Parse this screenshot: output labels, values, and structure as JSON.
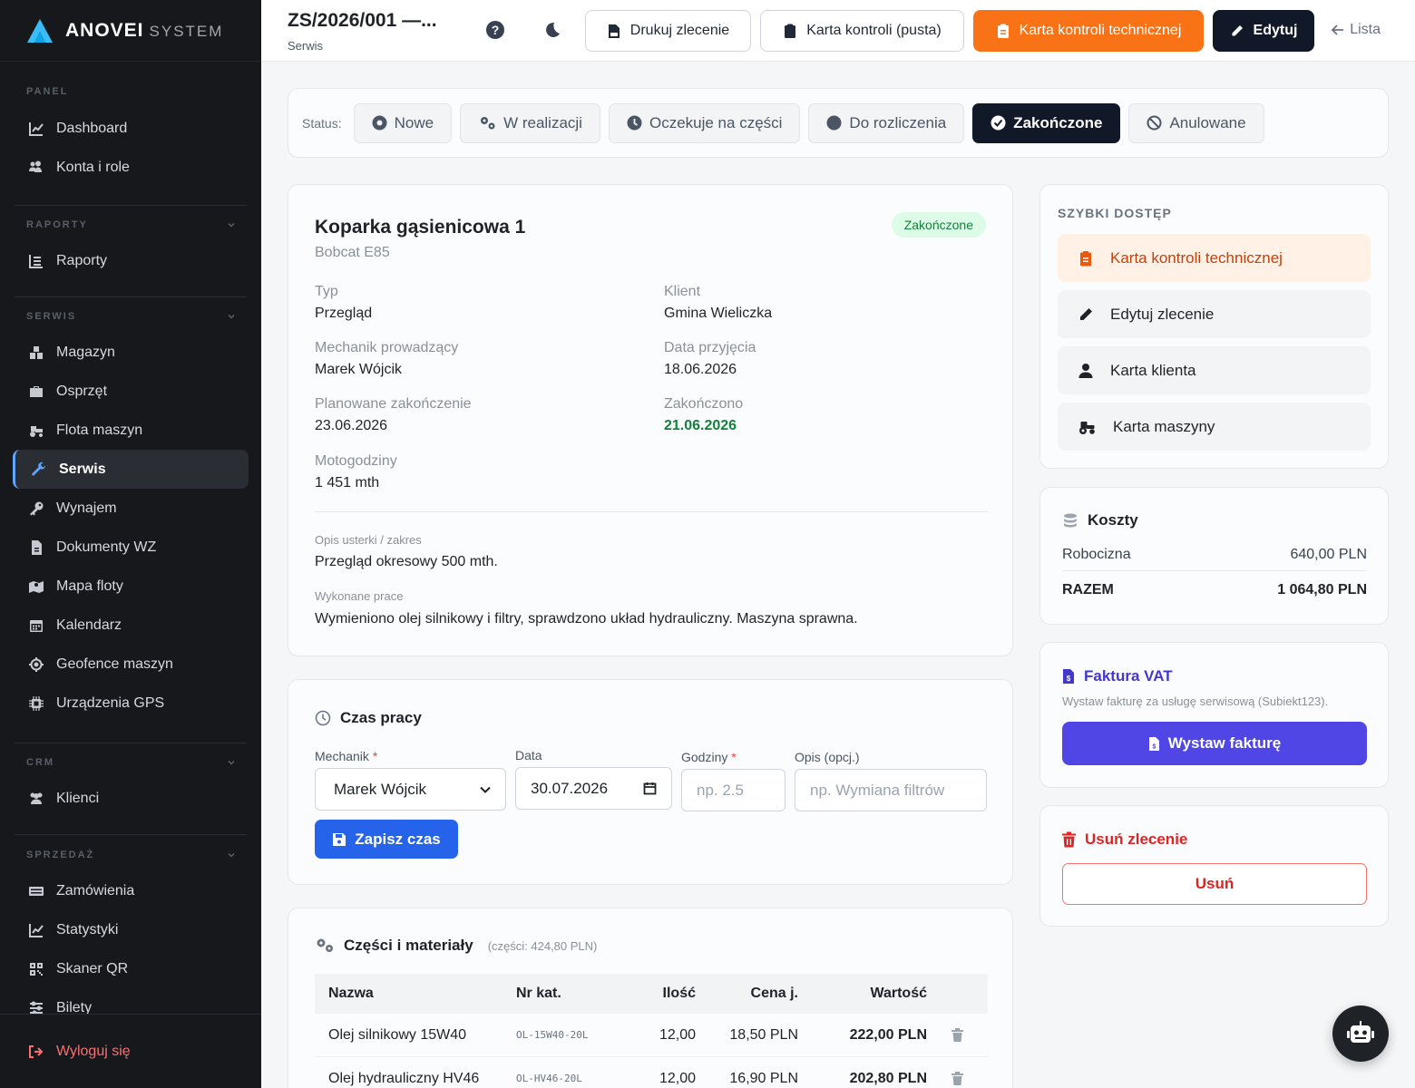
{
  "brand": {
    "name": "ANOVEI",
    "sub": "SYSTEM"
  },
  "sidebar": {
    "sections": [
      {
        "title": "PANEL",
        "items": [
          {
            "label": "Dashboard",
            "icon": "chart-line-icon"
          },
          {
            "label": "Konta i role",
            "icon": "users-gear-icon"
          }
        ]
      },
      {
        "title": "RAPORTY",
        "items": [
          {
            "label": "Raporty",
            "icon": "list-icon"
          }
        ]
      },
      {
        "title": "SERWIS",
        "items": [
          {
            "label": "Magazyn",
            "icon": "boxes-icon"
          },
          {
            "label": "Osprzęt",
            "icon": "toolbox-icon"
          },
          {
            "label": "Flota maszyn",
            "icon": "tractor-icon"
          },
          {
            "label": "Serwis",
            "icon": "wrench-icon",
            "active": true
          },
          {
            "label": "Wynajem",
            "icon": "key-icon"
          },
          {
            "label": "Dokumenty WZ",
            "icon": "file-icon"
          },
          {
            "label": "Mapa floty",
            "icon": "map-icon"
          },
          {
            "label": "Kalendarz",
            "icon": "calendar-icon"
          },
          {
            "label": "Geofence maszyn",
            "icon": "crosshair-icon"
          },
          {
            "label": "Urządzenia GPS",
            "icon": "chip-icon"
          }
        ]
      },
      {
        "title": "CRM",
        "items": [
          {
            "label": "Klienci",
            "icon": "users-icon"
          }
        ]
      },
      {
        "title": "SPRZEDAŻ",
        "items": [
          {
            "label": "Zamówienia",
            "icon": "cash-register-icon"
          },
          {
            "label": "Statystyki",
            "icon": "chart-line-icon"
          },
          {
            "label": "Skaner QR",
            "icon": "qr-icon"
          },
          {
            "label": "Bilety",
            "icon": "sliders-icon"
          }
        ]
      }
    ],
    "logout": "Wyloguj się"
  },
  "topbar": {
    "title": "ZS/2026/001 —...",
    "subtitle": "Serwis",
    "print_label": "Drukuj zlecenie",
    "blank_card_label": "Karta kontroli (pusta)",
    "tech_card_label": "Karta kontroli technicznej",
    "edit_label": "Edytuj",
    "list_label": "Lista"
  },
  "status": {
    "label": "Status:",
    "options": [
      {
        "label": "Nowe",
        "icon": "circle-dot-icon"
      },
      {
        "label": "W realizacji",
        "icon": "gears-icon"
      },
      {
        "label": "Oczekuje na części",
        "icon": "clock-icon"
      },
      {
        "label": "Do rozliczenia",
        "icon": "circle-icon"
      },
      {
        "label": "Zakończone",
        "icon": "check-circle-icon",
        "active": true
      },
      {
        "label": "Anulowane",
        "icon": "ban-icon"
      }
    ]
  },
  "machine": {
    "name": "Koparka gąsienicowa 1",
    "model": "Bobcat E85",
    "badge": "Zakończone",
    "fields": {
      "type_label": "Typ",
      "type": "Przegląd",
      "client_label": "Klient",
      "client": "Gmina Wieliczka",
      "mechanic_label": "Mechanik prowadzący",
      "mechanic": "Marek Wójcik",
      "received_label": "Data przyjęcia",
      "received": "18.06.2026",
      "planned_label": "Planowane zakończenie",
      "planned": "23.06.2026",
      "finished_label": "Zakończono",
      "finished": "21.06.2026",
      "hours_label": "Motogodziny",
      "hours": "1 451 mth"
    },
    "issue_label": "Opis usterki / zakres",
    "issue": "Przegląd okresowy 500 mth.",
    "work_label": "Wykonane prace",
    "work": "Wymieniono olej silnikowy i filtry, sprawdzono układ hydrauliczny. Maszyna sprawna."
  },
  "worktime": {
    "title": "Czas pracy",
    "mechanic_label": "Mechanik",
    "mechanic_value": "Marek Wójcik",
    "date_label": "Data",
    "date_value": "30.07.2026",
    "hours_label": "Godziny",
    "hours_placeholder": "np. 2.5",
    "desc_label": "Opis (opcj.)",
    "desc_placeholder": "np. Wymiana filtrów",
    "save_label": "Zapisz czas",
    "required_mark": "*"
  },
  "parts": {
    "title": "Części i materiały",
    "meta": "(części: 424,80 PLN)",
    "columns": [
      "Nazwa",
      "Nr kat.",
      "Ilość",
      "Cena j.",
      "Wartość"
    ],
    "rows": [
      {
        "name": "Olej silnikowy 15W40",
        "code": "OL-15W40-20L",
        "qty": "12,00",
        "price": "18,50 PLN",
        "value": "222,00 PLN"
      },
      {
        "name": "Olej hydrauliczny HV46",
        "code": "OL-HV46-20L",
        "qty": "12,00",
        "price": "16,90 PLN",
        "value": "202,80 PLN"
      }
    ]
  },
  "quick": {
    "title": "SZYBKI DOSTĘP",
    "items": [
      {
        "label": "Karta kontroli technicznej",
        "icon": "clipboard-icon"
      },
      {
        "label": "Edytuj zlecenie",
        "icon": "pencil-icon"
      },
      {
        "label": "Karta klienta",
        "icon": "user-icon"
      },
      {
        "label": "Karta maszyny",
        "icon": "tractor-icon"
      }
    ]
  },
  "costs": {
    "title": "Koszty",
    "labor_label": "Robocizna",
    "labor": "640,00 PLN",
    "total_label": "RAZEM",
    "total": "1 064,80 PLN"
  },
  "vat": {
    "title": "Faktura VAT",
    "desc": "Wystaw fakturę za usługę serwisową (Subiekt123).",
    "button": "Wystaw fakturę"
  },
  "delete": {
    "title": "Usuń zlecenie",
    "button": "Usuń"
  },
  "colors": {
    "accent": "#f97316",
    "primary": "#2563eb",
    "vat": "#4f46e5",
    "danger": "#dc2626",
    "success": "#15803d",
    "sidebar": "#16181c"
  }
}
